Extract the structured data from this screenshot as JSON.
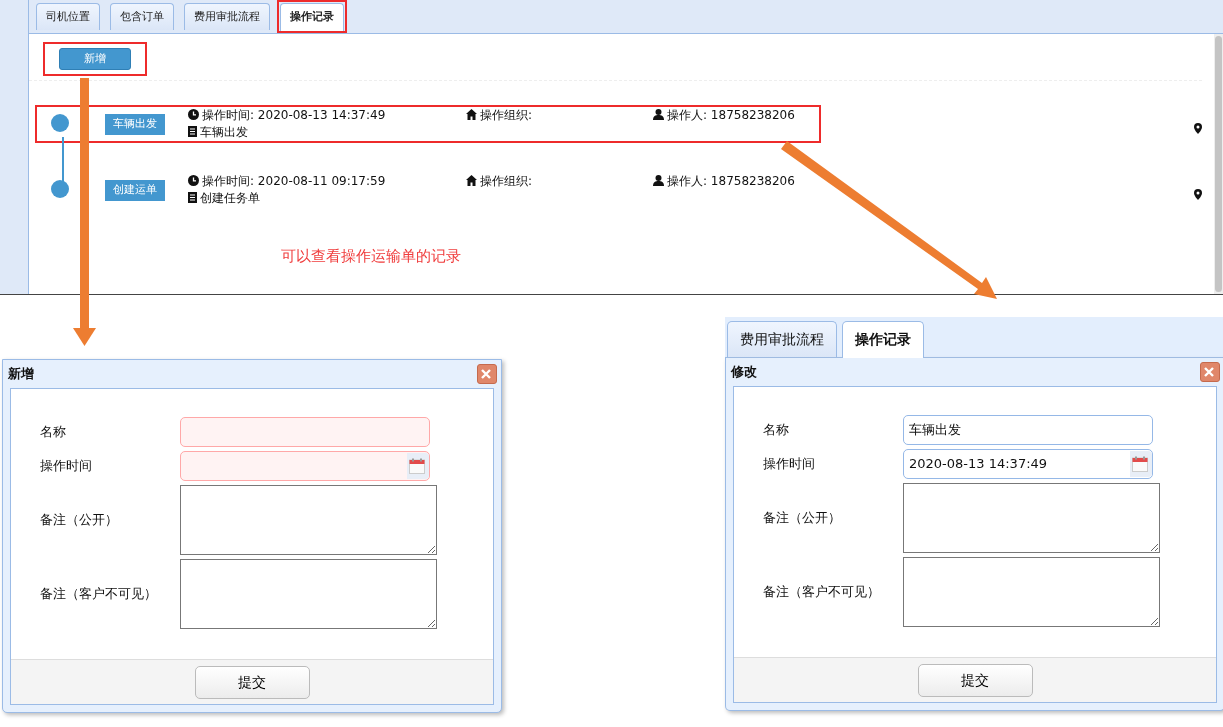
{
  "main_panel": {
    "tabs": [
      {
        "label": "司机位置",
        "selected": false,
        "highlighted": false
      },
      {
        "label": "包含订单",
        "selected": false,
        "highlighted": false
      },
      {
        "label": "费用审批流程",
        "selected": false,
        "highlighted": false
      },
      {
        "label": "操作记录",
        "selected": true,
        "highlighted": true
      }
    ],
    "add_button": {
      "label": "新增",
      "highlighted": true
    },
    "records": [
      {
        "tag": "车辆出发",
        "time": "操作时间: 2020-08-13 14:37:49",
        "org": "操作组织:",
        "operator": "操作人: 18758238206",
        "remark": "车辆出发",
        "highlighted": true
      },
      {
        "tag": "创建运单",
        "time": "操作时间: 2020-08-11 09:17:59",
        "org": "操作组织:",
        "operator": "操作人: 18758238206",
        "remark": "创建任务单",
        "highlighted": false
      }
    ],
    "annotation": "可以查看操作运输单的记录"
  },
  "add_dialog": {
    "title": "新增",
    "fields": [
      {
        "label": "名称",
        "kind": "text",
        "invalid": true
      },
      {
        "label": "操作时间",
        "kind": "date",
        "invalid": true
      },
      {
        "label": "备注（公开）",
        "kind": "textarea",
        "invalid": false
      },
      {
        "label": "备注（客户不可见）",
        "kind": "textarea",
        "invalid": false
      }
    ],
    "submit": "提交"
  },
  "edit_dialog": {
    "tabs": [
      {
        "label": "费用审批流程",
        "selected": false
      },
      {
        "label": "操作记录",
        "selected": true
      }
    ],
    "title": "修改",
    "fields": [
      {
        "label": "名称",
        "kind": "text",
        "invalid": false,
        "value": "车辆出发"
      },
      {
        "label": "操作时间",
        "kind": "date",
        "invalid": false,
        "value": "2020-08-13 14:37:49"
      },
      {
        "label": "备注（公开）",
        "kind": "textarea",
        "invalid": false
      },
      {
        "label": "备注（客户不可见）",
        "kind": "textarea",
        "invalid": false
      }
    ],
    "submit": "提交"
  }
}
